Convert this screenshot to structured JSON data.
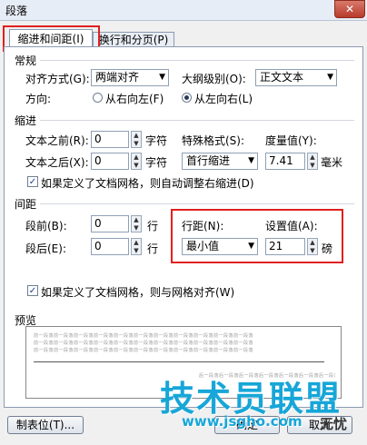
{
  "window": {
    "title": "段落",
    "close_glyph": "✕"
  },
  "tabs": [
    {
      "label": "缩进和间距(I)",
      "active": true
    },
    {
      "label": "换行和分页(P)",
      "active": false
    }
  ],
  "general": {
    "section_title": "常规",
    "alignment_label": "对齐方式(G):",
    "alignment_value": "两端对齐",
    "outline_label": "大纲级别(O):",
    "outline_value": "正文文本",
    "direction_label": "方向:",
    "rtl_label": "从右向左(F)",
    "ltr_label": "从左向右(L)",
    "direction_selected": "ltr"
  },
  "indent": {
    "section_title": "缩进",
    "before_label": "文本之前(R):",
    "before_value": "0",
    "before_unit": "字符",
    "after_label": "文本之后(X):",
    "after_value": "0",
    "after_unit": "字符",
    "special_label": "特殊格式(S):",
    "special_value": "首行缩进",
    "measure_label": "度量值(Y):",
    "measure_value": "7.41",
    "measure_unit": "毫米",
    "auto_adjust_label": "如果定义了文档网格，则自动调整右缩进(D)",
    "auto_adjust_checked": true
  },
  "spacing": {
    "section_title": "间距",
    "before_label": "段前(B):",
    "before_value": "0",
    "before_unit": "行",
    "after_label": "段后(E):",
    "after_value": "0",
    "after_unit": "行",
    "line_label": "行距(N):",
    "line_value": "最小值",
    "setting_label": "设置值(A):",
    "setting_value": "21",
    "setting_unit": "磅",
    "snap_grid_label": "如果定义了文档网格，则与网格对齐(W)",
    "snap_grid_checked": true
  },
  "preview": {
    "section_title": "预览",
    "prev_text": "前一段落前一段落前一段落前一段落前一段落前一段落前一段落前一段落前一段落前一段落前一段落",
    "next_text": "后一段落后一段落后一段落后一段落后一段落后一段落后一段落"
  },
  "footer": {
    "tabs_button": "制表位(T)...",
    "ok_button": "确定",
    "cancel_button": "取消"
  },
  "watermark": {
    "text": "技术员联盟",
    "url": "www.jsgho.com",
    "badge": "无忧"
  },
  "colors": {
    "highlight_box": "#e02020",
    "watermark": "#17a6d8"
  }
}
